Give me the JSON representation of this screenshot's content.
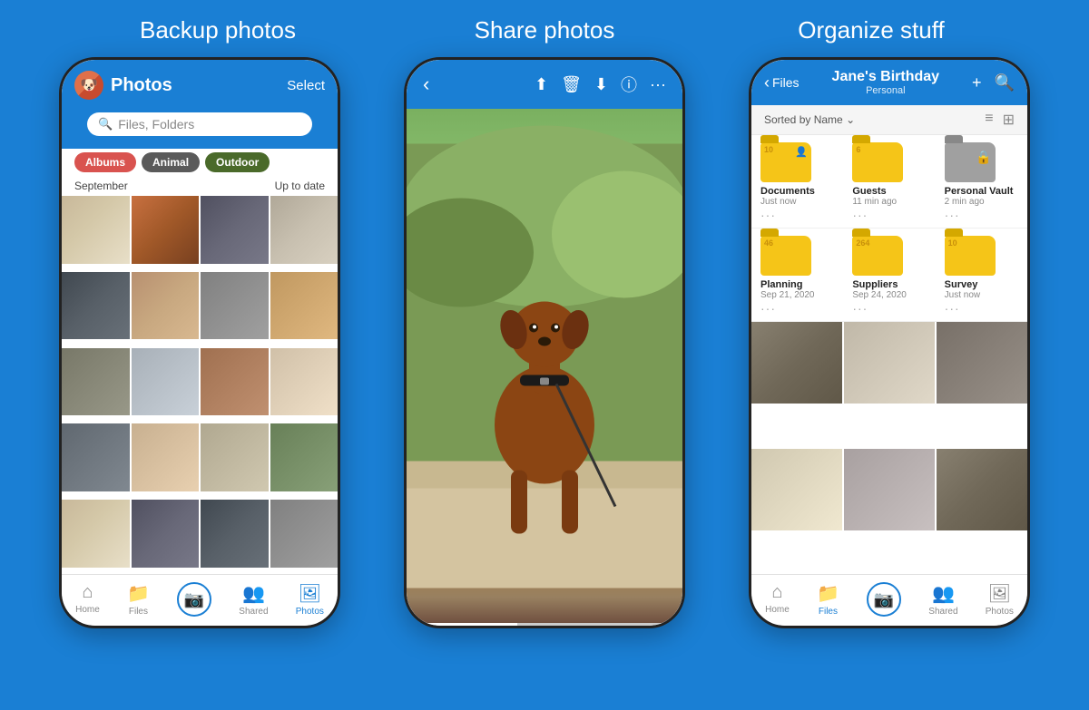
{
  "background_color": "#1a7fd4",
  "features": [
    {
      "id": "backup",
      "title": "Backup photos"
    },
    {
      "id": "share",
      "title": "Share photos"
    },
    {
      "id": "organize",
      "title": "Organize stuff"
    }
  ],
  "phone1": {
    "header": {
      "title": "Photos",
      "select_label": "Select",
      "search_placeholder": "Files, Folders"
    },
    "tags": [
      "Albums",
      "Animal",
      "Outdoor"
    ],
    "section_label": "September",
    "section_status": "Up to date",
    "nav_items": [
      {
        "label": "Home",
        "icon": "🏠",
        "active": false
      },
      {
        "label": "Files",
        "icon": "📁",
        "active": false
      },
      {
        "label": "",
        "icon": "📷",
        "active": false,
        "is_camera": true
      },
      {
        "label": "Shared",
        "icon": "👥",
        "active": false
      },
      {
        "label": "Photos",
        "icon": "🖼",
        "active": true
      }
    ]
  },
  "phone2": {
    "progress": 40
  },
  "phone3": {
    "header": {
      "back_label": "Files",
      "title": "Jane's Birthday",
      "subtitle": "Personal"
    },
    "sort_label": "Sorted by Name",
    "folders": [
      {
        "name": "Documents",
        "date": "Just now",
        "count": "10",
        "type": "yellow",
        "has_share": true
      },
      {
        "name": "Guests",
        "date": "11 min ago",
        "count": "6",
        "type": "yellow",
        "has_share": false
      },
      {
        "name": "Personal Vault",
        "date": "2 min ago",
        "count": "",
        "type": "gray",
        "is_vault": true
      },
      {
        "name": "Planning",
        "date": "Sep 21, 2020",
        "count": "46",
        "type": "yellow",
        "has_share": false
      },
      {
        "name": "Suppliers",
        "date": "Sep 24, 2020",
        "count": "264",
        "type": "yellow",
        "has_share": false
      },
      {
        "name": "Survey",
        "date": "Just now",
        "count": "10",
        "type": "yellow",
        "has_share": false
      }
    ],
    "nav_items": [
      {
        "label": "Home",
        "icon": "🏠",
        "active": false
      },
      {
        "label": "Files",
        "icon": "📁",
        "active": true
      },
      {
        "label": "",
        "icon": "📷",
        "active": false,
        "is_camera": true
      },
      {
        "label": "Shared",
        "icon": "👥",
        "active": false
      },
      {
        "label": "Photos",
        "icon": "🖼",
        "active": false
      }
    ]
  }
}
